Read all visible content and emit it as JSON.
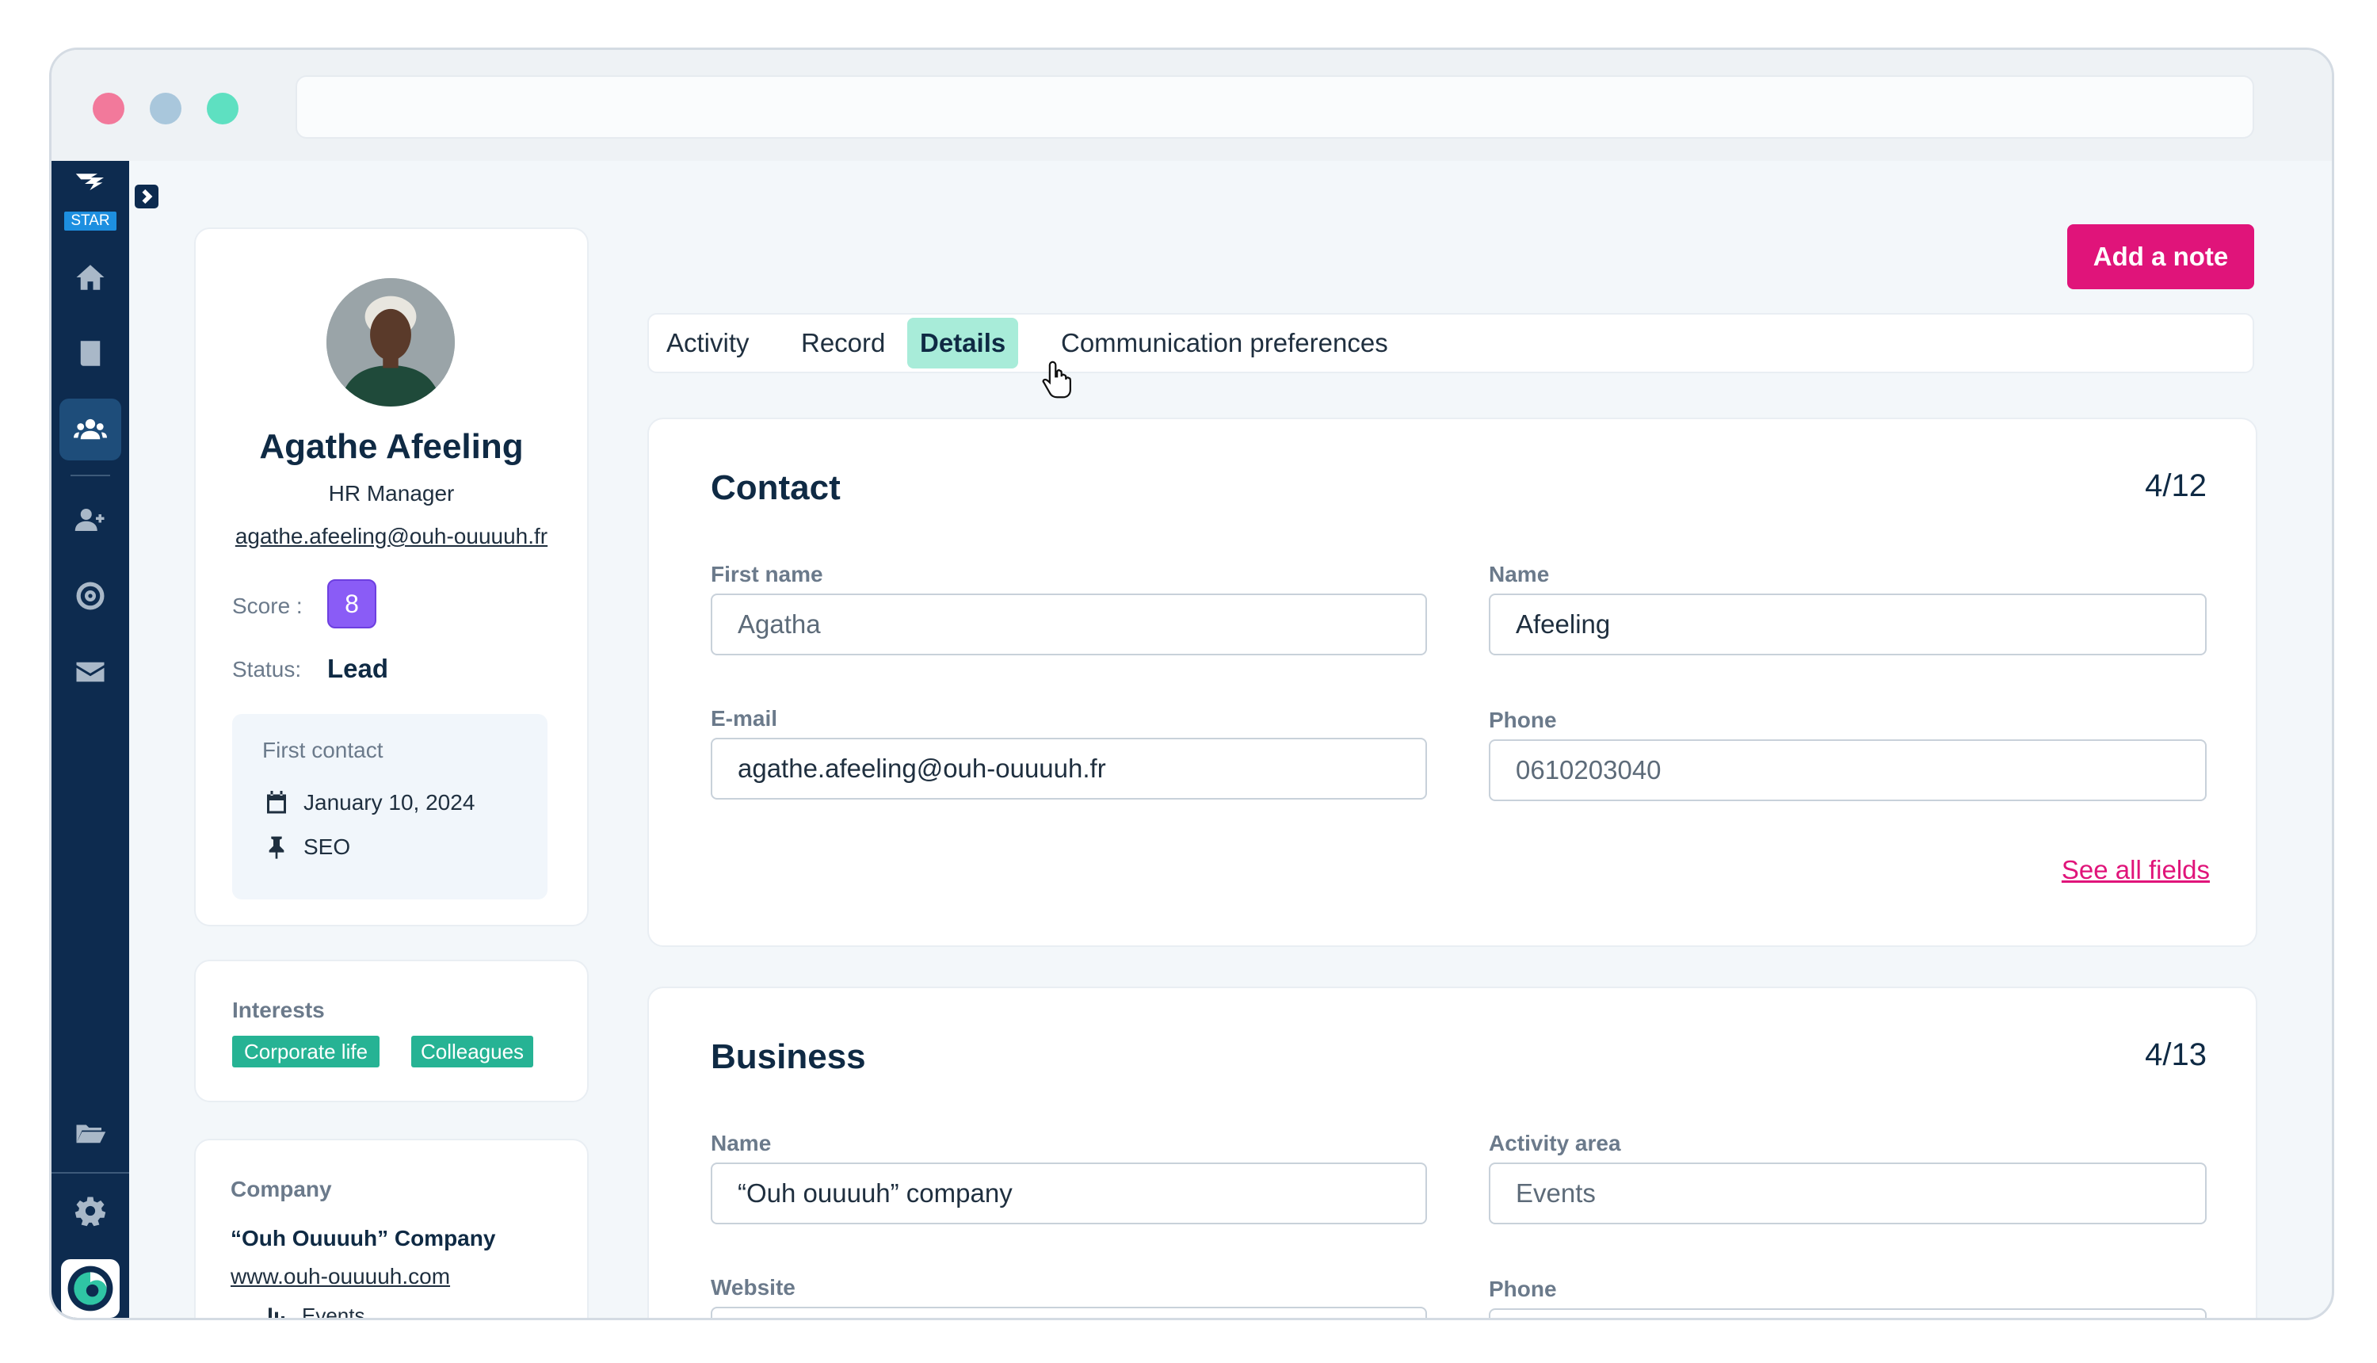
{
  "sidebar": {
    "logo_badge": "STAR",
    "icons": [
      "home-icon",
      "book-icon",
      "users-icon",
      "user-plus-icon",
      "target-icon",
      "mail-icon",
      "folder-icon",
      "settings-icon"
    ]
  },
  "profile": {
    "name": "Agathe Afeeling",
    "role": "HR Manager",
    "email": "agathe.afeeling@ouh-ouuuuh.fr",
    "score_label": "Score :",
    "score_value": "8",
    "status_label": "Status:",
    "status_value": "Lead",
    "first_contact_label": "First contact",
    "first_contact_date": "January 10, 2024",
    "first_contact_source": "SEO"
  },
  "interests": {
    "label": "Interests",
    "tags": [
      "Corporate life",
      "Colleagues"
    ]
  },
  "company": {
    "label": "Company",
    "name": "“Ouh Ouuuuh” Company",
    "website": "www.ouh-ouuuuh.com",
    "area": "Events"
  },
  "actions": {
    "add_note": "Add a note"
  },
  "tabs": [
    {
      "label": "Activity"
    },
    {
      "label": "Record"
    },
    {
      "label": "Details",
      "active": true
    },
    {
      "label": "Communication preferences"
    }
  ],
  "contact_section": {
    "title": "Contact",
    "count": "4/12",
    "first_name_label": "First name",
    "first_name_placeholder": "Agatha",
    "name_label": "Name",
    "name_value": "Afeeling",
    "email_label": "E-mail",
    "email_value": "agathe.afeeling@ouh-ouuuuh.fr",
    "phone_label": "Phone",
    "phone_value": "0610203040",
    "see_all": "See all fields"
  },
  "business_section": {
    "title": "Business",
    "count": "4/13",
    "name_label": "Name",
    "name_value": "“Ouh ouuuuh” company",
    "activity_label": "Activity area",
    "activity_value": "Events",
    "website_label": "Website",
    "phone_label": "Phone"
  },
  "colors": {
    "sidebar": "#0d2b4f",
    "accent": "#e0147a",
    "score": "#8a5cf6",
    "tag": "#26b394",
    "active_tab": "#a8ecd9"
  }
}
